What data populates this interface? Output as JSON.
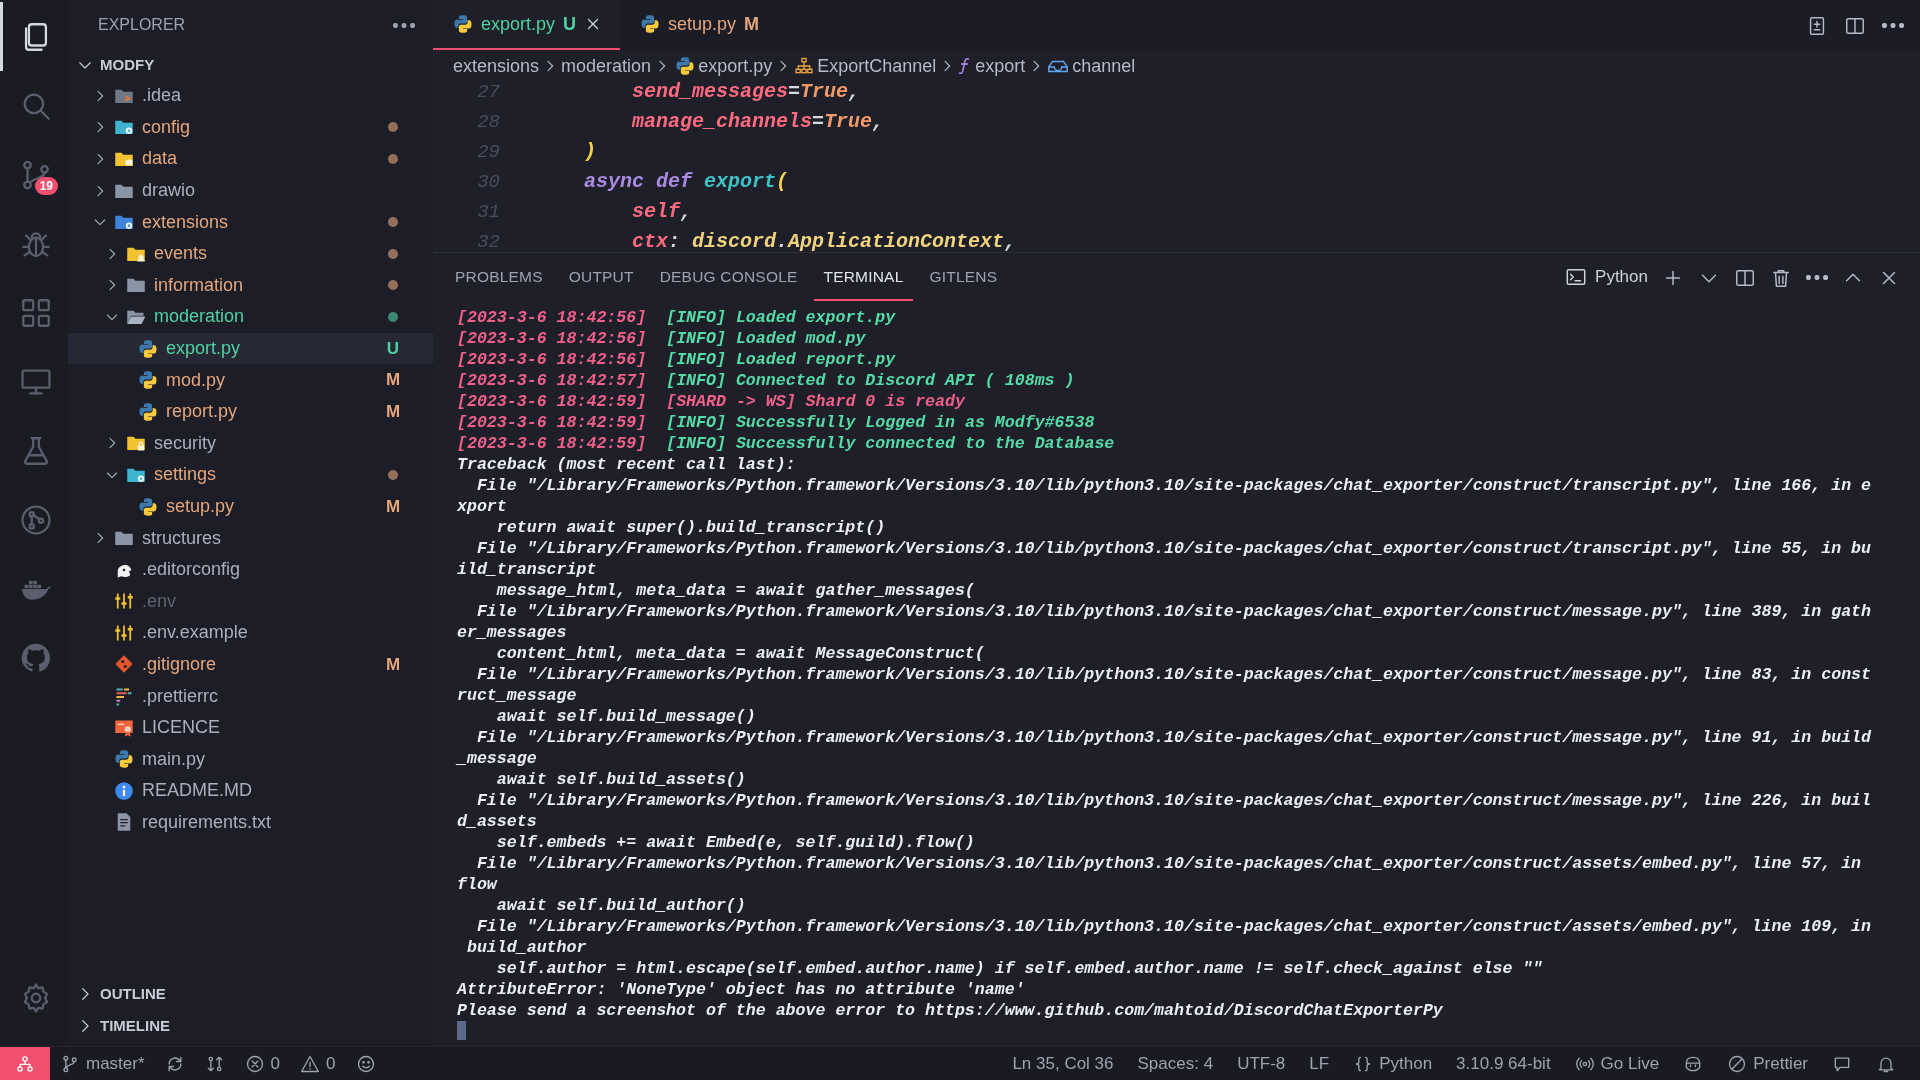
{
  "activity_bar": {
    "items": [
      {
        "selected": true
      },
      {
        "selected": false
      },
      {
        "selected": false,
        "badge": "19"
      },
      {
        "selected": false
      },
      {
        "selected": false
      },
      {
        "selected": false
      },
      {
        "selected": false
      },
      {
        "selected": false
      },
      {
        "selected": false
      },
      {
        "selected": false
      }
    ],
    "bottom": [
      {
        "selected": false
      }
    ]
  },
  "explorer": {
    "title": "EXPLORER",
    "root": {
      "label": "MODFY",
      "expanded": true
    },
    "tree": [
      {
        "name": ".idea",
        "kind": "folder-idea",
        "color": "#aab0bc",
        "expanded": false,
        "selected": false
      },
      {
        "name": "config",
        "kind": "folder-gear",
        "color": "#e4a67c",
        "dot": true,
        "expanded": false,
        "selected": false
      },
      {
        "name": "data",
        "kind": "folder-data",
        "color": "#e4a67c",
        "dot": true,
        "expanded": false,
        "selected": false
      },
      {
        "name": "drawio",
        "kind": "folder",
        "color": "#aab0bc",
        "expanded": false,
        "selected": false
      },
      {
        "name": "extensions",
        "kind": "folder-gear-blue",
        "color": "#e4a67c",
        "dot": true,
        "expanded": true,
        "selected": false,
        "children": [
          {
            "name": "events",
            "kind": "folder-bell",
            "color": "#e4a67c",
            "dot": true,
            "expanded": false,
            "selected": false
          },
          {
            "name": "information",
            "kind": "folder",
            "color": "#e4a67c",
            "dot": true,
            "expanded": false,
            "selected": false
          },
          {
            "name": "moderation",
            "kind": "folder-open",
            "color": "#4fd1a1",
            "dot": true,
            "expanded": true,
            "selected": false,
            "children": [
              {
                "name": "export.py",
                "kind": "python",
                "color": "#4fd1a1",
                "badge": "U",
                "selected": true
              },
              {
                "name": "mod.py",
                "kind": "python",
                "color": "#e4a67c",
                "badge": "M",
                "selected": false
              },
              {
                "name": "report.py",
                "kind": "python",
                "color": "#e4a67c",
                "badge": "M",
                "selected": false
              }
            ]
          },
          {
            "name": "security",
            "kind": "folder-lock",
            "color": "#aab0bc",
            "expanded": false,
            "selected": false
          },
          {
            "name": "settings",
            "kind": "folder-gear",
            "color": "#e4a67c",
            "dot": true,
            "expanded": true,
            "selected": false,
            "children": [
              {
                "name": "setup.py",
                "kind": "python",
                "color": "#e4a67c",
                "badge": "M",
                "selected": false
              }
            ]
          }
        ]
      },
      {
        "name": "structures",
        "kind": "folder",
        "color": "#aab0bc",
        "expanded": false,
        "selected": false
      },
      {
        "name": ".editorconfig",
        "kind": "editorconfig",
        "color": "#aab0bc",
        "selected": false
      },
      {
        "name": ".env",
        "kind": "sliders",
        "color": "#5f636f",
        "selected": false
      },
      {
        "name": ".env.example",
        "kind": "sliders",
        "color": "#aab0bc",
        "selected": false
      },
      {
        "name": ".gitignore",
        "kind": "git",
        "color": "#e4a67c",
        "badge": "M",
        "selected": false
      },
      {
        "name": ".prettierrc",
        "kind": "prettier",
        "color": "#aab0bc",
        "selected": false
      },
      {
        "name": "LICENCE",
        "kind": "license",
        "color": "#aab0bc",
        "selected": false
      },
      {
        "name": "main.py",
        "kind": "python",
        "color": "#aab0bc",
        "selected": false
      },
      {
        "name": "README.MD",
        "kind": "info",
        "color": "#aab0bc",
        "selected": false
      },
      {
        "name": "requirements.txt",
        "kind": "text",
        "color": "#aab0bc",
        "selected": false
      }
    ],
    "sections": [
      {
        "label": "OUTLINE",
        "expanded": false
      },
      {
        "label": "TIMELINE",
        "expanded": false
      }
    ]
  },
  "editor": {
    "tabs": [
      {
        "label": "export.py",
        "badge": "U",
        "color": "#4fd1a1",
        "selected": true
      },
      {
        "label": "setup.py",
        "badge": "M",
        "color": "#e4a67c",
        "selected": false
      }
    ],
    "breadcrumbs": [
      {
        "text": "extensions",
        "kind": "folder"
      },
      {
        "text": "moderation",
        "kind": "folder"
      },
      {
        "text": "export.py",
        "kind": "python"
      },
      {
        "text": "ExportChannel",
        "kind": "class"
      },
      {
        "text": "export",
        "kind": "function"
      },
      {
        "text": "channel",
        "kind": "field"
      }
    ],
    "lines": [
      {
        "number": "27",
        "tokens": [
          {
            "text": "        send_messages",
            "kind": "param"
          },
          {
            "text": "=",
            "kind": "op"
          },
          {
            "text": "True",
            "kind": "const"
          },
          {
            "text": ",",
            "kind": "op"
          }
        ]
      },
      {
        "number": "28",
        "tokens": [
          {
            "text": "        manage_channels",
            "kind": "param"
          },
          {
            "text": "=",
            "kind": "op"
          },
          {
            "text": "True",
            "kind": "const"
          },
          {
            "text": ",",
            "kind": "op"
          }
        ]
      },
      {
        "number": "29",
        "tokens": [
          {
            "text": "    )",
            "kind": "bracket"
          }
        ]
      },
      {
        "number": "30",
        "tokens": [
          {
            "text": "    async def ",
            "kind": "keyword"
          },
          {
            "text": "export",
            "kind": "func"
          },
          {
            "text": "(",
            "kind": "bracket"
          }
        ]
      },
      {
        "number": "31",
        "tokens": [
          {
            "text": "        self",
            "kind": "param"
          },
          {
            "text": ",",
            "kind": "op"
          }
        ]
      },
      {
        "number": "32",
        "tokens": [
          {
            "text": "        ctx",
            "kind": "param"
          },
          {
            "text": ": ",
            "kind": "op"
          },
          {
            "text": "discord",
            "kind": "class"
          },
          {
            "text": ".",
            "kind": "op"
          },
          {
            "text": "ApplicationContext",
            "kind": "class"
          },
          {
            "text": ",",
            "kind": "op"
          }
        ]
      }
    ]
  },
  "panel": {
    "tabs": [
      {
        "label": "PROBLEMS",
        "selected": false
      },
      {
        "label": "OUTPUT",
        "selected": false
      },
      {
        "label": "DEBUG CONSOLE",
        "selected": false
      },
      {
        "label": "TERMINAL",
        "selected": true
      },
      {
        "label": "GITLENS",
        "selected": false
      }
    ],
    "terminal_name": "Python",
    "terminal": [
      {
        "kind": "log",
        "timestamp": "[2023-3-6 18:42:56]",
        "color": "#55dba6",
        "text": "[INFO] Loaded export.py"
      },
      {
        "kind": "log",
        "timestamp": "[2023-3-6 18:42:56]",
        "color": "#55dba6",
        "text": "[INFO] Loaded mod.py"
      },
      {
        "kind": "log",
        "timestamp": "[2023-3-6 18:42:56]",
        "color": "#55dba6",
        "text": "[INFO] Loaded report.py"
      },
      {
        "kind": "log",
        "timestamp": "[2023-3-6 18:42:57]",
        "color": "#55dba6",
        "text": "[INFO] Connected to Discord API ( 108ms )"
      },
      {
        "kind": "log",
        "timestamp": "[2023-3-6 18:42:59]",
        "color": "#f0608a",
        "text": "[SHARD -> WS] Shard 0 is ready"
      },
      {
        "kind": "log",
        "timestamp": "[2023-3-6 18:42:59]",
        "color": "#55dba6",
        "text": "[INFO] Successfully Logged in as Modfy#6538"
      },
      {
        "kind": "log",
        "timestamp": "[2023-3-6 18:42:59]",
        "color": "#55dba6",
        "text": "[INFO] Successfully connected to the Database"
      },
      {
        "kind": "plain",
        "text": "Traceback (most recent call last):"
      },
      {
        "kind": "plain",
        "text": "  File \"/Library/Frameworks/Python.framework/Versions/3.10/lib/python3.10/site-packages/chat_exporter/construct/transcript.py\", line 166, in e"
      },
      {
        "kind": "plain",
        "text": "xport"
      },
      {
        "kind": "plain",
        "text": "    return await super().build_transcript()"
      },
      {
        "kind": "plain",
        "text": "  File \"/Library/Frameworks/Python.framework/Versions/3.10/lib/python3.10/site-packages/chat_exporter/construct/transcript.py\", line 55, in bu"
      },
      {
        "kind": "plain",
        "text": "ild_transcript"
      },
      {
        "kind": "plain",
        "text": "    message_html, meta_data = await gather_messages("
      },
      {
        "kind": "plain",
        "text": "  File \"/Library/Frameworks/Python.framework/Versions/3.10/lib/python3.10/site-packages/chat_exporter/construct/message.py\", line 389, in gath"
      },
      {
        "kind": "plain",
        "text": "er_messages"
      },
      {
        "kind": "plain",
        "text": "    content_html, meta_data = await MessageConstruct("
      },
      {
        "kind": "plain",
        "text": "  File \"/Library/Frameworks/Python.framework/Versions/3.10/lib/python3.10/site-packages/chat_exporter/construct/message.py\", line 83, in const"
      },
      {
        "kind": "plain",
        "text": "ruct_message"
      },
      {
        "kind": "plain",
        "text": "    await self.build_message()"
      },
      {
        "kind": "plain",
        "text": "  File \"/Library/Frameworks/Python.framework/Versions/3.10/lib/python3.10/site-packages/chat_exporter/construct/message.py\", line 91, in build"
      },
      {
        "kind": "plain",
        "text": "_message"
      },
      {
        "kind": "plain",
        "text": "    await self.build_assets()"
      },
      {
        "kind": "plain",
        "text": "  File \"/Library/Frameworks/Python.framework/Versions/3.10/lib/python3.10/site-packages/chat_exporter/construct/message.py\", line 226, in buil"
      },
      {
        "kind": "plain",
        "text": "d_assets"
      },
      {
        "kind": "plain",
        "text": "    self.embeds += await Embed(e, self.guild).flow()"
      },
      {
        "kind": "plain",
        "text": "  File \"/Library/Frameworks/Python.framework/Versions/3.10/lib/python3.10/site-packages/chat_exporter/construct/assets/embed.py\", line 57, in"
      },
      {
        "kind": "plain",
        "text": "flow"
      },
      {
        "kind": "plain",
        "text": "    await self.build_author()"
      },
      {
        "kind": "plain",
        "text": "  File \"/Library/Frameworks/Python.framework/Versions/3.10/lib/python3.10/site-packages/chat_exporter/construct/assets/embed.py\", line 109, in"
      },
      {
        "kind": "plain",
        "text": " build_author"
      },
      {
        "kind": "plain",
        "text": "    self.author = html.escape(self.embed.author.name) if self.embed.author.name != self.check_against else \"\""
      },
      {
        "kind": "plain",
        "text": "AttributeError: 'NoneType' object has no attribute 'name'"
      },
      {
        "kind": "plain",
        "text": "Please send a screenshot of the above error to https://www.github.com/mahtoid/DiscordChatExporterPy"
      },
      {
        "kind": "cursor"
      }
    ]
  },
  "status_bar": {
    "left": [
      {
        "kind": "remote"
      },
      {
        "kind": "branch",
        "text": "master*"
      },
      {
        "kind": "sync"
      },
      {
        "kind": "compare"
      },
      {
        "kind": "error",
        "text": "0"
      },
      {
        "kind": "warning",
        "text": "0"
      },
      {
        "kind": "smile"
      }
    ],
    "right": [
      {
        "kind": "plain",
        "text": "Ln 35, Col 36"
      },
      {
        "kind": "plain",
        "text": "Spaces: 4"
      },
      {
        "kind": "plain",
        "text": "UTF-8"
      },
      {
        "kind": "plain",
        "text": "LF"
      },
      {
        "kind": "braces",
        "text": "Python"
      },
      {
        "kind": "plain",
        "text": "3.10.9 64-bit"
      },
      {
        "kind": "broadcast",
        "text": "Go Live"
      },
      {
        "kind": "copilot"
      },
      {
        "kind": "slash-circle",
        "text": "Prettier"
      },
      {
        "kind": "feedback"
      },
      {
        "kind": "bell"
      }
    ]
  }
}
